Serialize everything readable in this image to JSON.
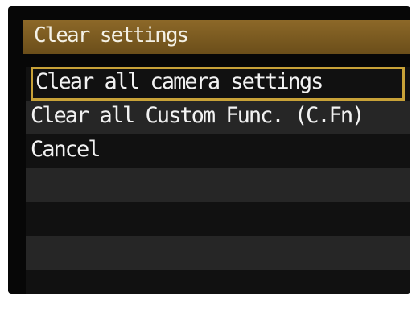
{
  "screen": {
    "title": "Clear settings",
    "menu": [
      {
        "label": "Clear all camera settings",
        "selected": true
      },
      {
        "label": "Clear all Custom Func. (C.Fn)",
        "selected": false
      },
      {
        "label": "Cancel",
        "selected": false
      }
    ]
  },
  "colors": {
    "title_bar": "#7a5a22",
    "selection_border": "#c8a238",
    "background": "#070707",
    "row_dark": "#111111",
    "row_light": "#262626",
    "text": "#f2f2f2"
  }
}
